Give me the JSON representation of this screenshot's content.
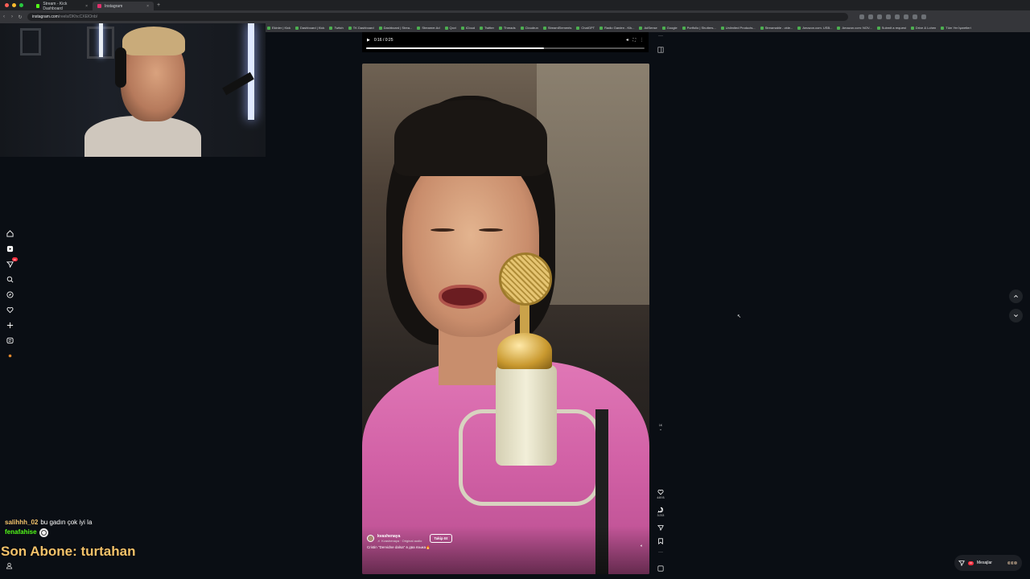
{
  "browser": {
    "tabs": [
      {
        "label": "Stream - Kick Dashboard",
        "active": false
      },
      {
        "label": "Instagram",
        "active": true
      }
    ],
    "url_host": "instagram.com",
    "url_path": "/reels/DKhcCXEIOnb/",
    "bookmarks": [
      "Ekinler | Kick",
      "Dashboard | Kick",
      "Twitch",
      "TK Dashboard",
      "Dashboard | Strea...",
      "Streamer.Ad",
      "Qovi",
      "iCloud",
      "Twitter",
      "Threads",
      "Cloudrun",
      "StreamElements",
      "ChatGPT",
      "Radio Garden - Kik...",
      "AdSense",
      "Google",
      "Portfolio | Shutters...",
      "Unlimited Products...",
      "Streamable - vide...",
      "Amazon.com. USB...",
      "Amazon.com: NOV...",
      "Submit a request",
      "Drive & Lohen",
      "Tüm Yer İşaretleri"
    ]
  },
  "chat": {
    "messages": [
      {
        "user": "salihhh_02",
        "text": "bu gadın çok iyi la"
      },
      {
        "user": "fenafahise",
        "text": ""
      }
    ],
    "last_sub": "Son Abone: turtahan"
  },
  "sidebar": {
    "icons": [
      "home-icon",
      "reels-icon",
      "direct-icon",
      "search-icon",
      "explore-icon",
      "heart-icon",
      "create-icon",
      "threads-icon",
      "profile-icon"
    ],
    "badge": "10"
  },
  "player": {
    "time": "0:16 / 0:25",
    "progress": 0.64
  },
  "reel": {
    "username": "kvashenaya",
    "audio": "♬ Kvashenaya · Original audio",
    "follow_label": "Takip Et",
    "caption": "Cristin \"Dervidne dalsa\" в два языка🔥"
  },
  "actions": {
    "reel_count": "1K",
    "likes": "449 B",
    "comments": "3.213"
  },
  "messages_pill": {
    "label": "Mesajlar",
    "badge": "10"
  }
}
